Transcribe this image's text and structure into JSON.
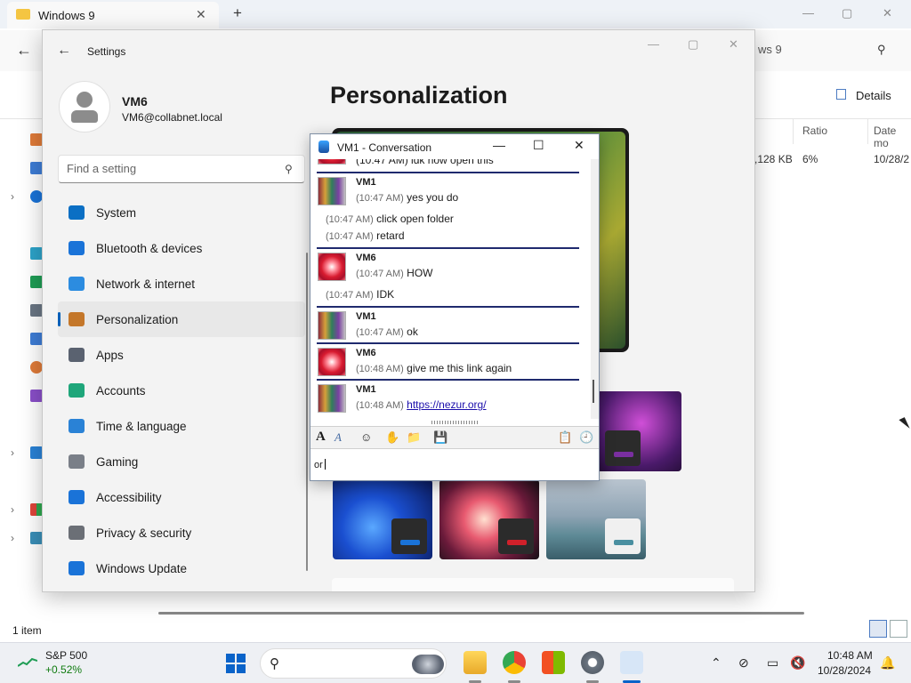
{
  "explorer": {
    "tab_title": "Windows 9",
    "tab_close": "✕",
    "new_tab": "+",
    "back": "←",
    "address_tail": "ws 9",
    "details_label": "Details",
    "columns": {
      "ratio": "Ratio",
      "date": "Date mo"
    },
    "row": {
      "size": ",128 KB",
      "ratio": "6%",
      "date": "10/28/2"
    },
    "status": "1 item",
    "window_controls": {
      "minimize": "—",
      "maximize": "▢",
      "close": "✕"
    }
  },
  "settings": {
    "app_title": "Settings",
    "back": "←",
    "window_controls": {
      "minimize": "—",
      "maximize": "▢",
      "close": "✕"
    },
    "user": {
      "name": "VM6",
      "email": "VM6@collabnet.local"
    },
    "search_placeholder": "Find a setting",
    "search_icon": "search-icon",
    "nav": [
      {
        "label": "System",
        "icon": "system-icon",
        "color": "#0b6fc4",
        "active": false
      },
      {
        "label": "Bluetooth & devices",
        "icon": "bluetooth-icon",
        "color": "#1a73d8",
        "active": false
      },
      {
        "label": "Network & internet",
        "icon": "wifi-icon",
        "color": "#2c8ce0",
        "active": false
      },
      {
        "label": "Personalization",
        "icon": "brush-icon",
        "color": "#c4772a",
        "active": true
      },
      {
        "label": "Apps",
        "icon": "apps-icon",
        "color": "#5a6270",
        "active": false
      },
      {
        "label": "Accounts",
        "icon": "accounts-icon",
        "color": "#1fa67a",
        "active": false
      },
      {
        "label": "Time & language",
        "icon": "clock-globe-icon",
        "color": "#2a82d6",
        "active": false
      },
      {
        "label": "Gaming",
        "icon": "gamepad-icon",
        "color": "#7a7f88",
        "active": false
      },
      {
        "label": "Accessibility",
        "icon": "accessibility-icon",
        "color": "#1a73d8",
        "active": false
      },
      {
        "label": "Privacy & security",
        "icon": "shield-icon",
        "color": "#6b6f76",
        "active": false
      },
      {
        "label": "Windows Update",
        "icon": "update-icon",
        "color": "#1a73d8",
        "active": false
      }
    ],
    "page_title": "Personalization"
  },
  "conversation": {
    "title": "VM1 - Conversation",
    "window_controls": {
      "minimize": "—",
      "maximize": "☐",
      "close": "✕"
    },
    "partial_top": "(10:47 AM) idk how open this",
    "blocks": [
      {
        "sender": "VM1",
        "avatar": "vm1",
        "lines": [
          {
            "time": "(10:47 AM)",
            "text": "yes you do"
          }
        ]
      },
      {
        "sender": "",
        "avatar": "",
        "lines": [
          {
            "time": "(10:47 AM)",
            "text": "click open folder"
          },
          {
            "time": "(10:47 AM)",
            "text": "retard"
          }
        ]
      },
      {
        "sender": "VM6",
        "avatar": "vm6",
        "lines": [
          {
            "time": "(10:47 AM)",
            "text": "HOW"
          }
        ]
      },
      {
        "sender": "",
        "avatar": "",
        "lines": [
          {
            "time": "(10:47 AM)",
            "text": "IDK"
          }
        ]
      },
      {
        "sender": "VM1",
        "avatar": "vm1",
        "lines": [
          {
            "time": "(10:47 AM)",
            "text": "ok"
          }
        ]
      },
      {
        "sender": "VM6",
        "avatar": "vm6",
        "lines": [
          {
            "time": "(10:48 AM)",
            "text": "give me this link again"
          }
        ]
      },
      {
        "sender": "VM1",
        "avatar": "vm1",
        "lines": [
          {
            "time": "(10:48 AM)",
            "text": "https://nezur.org/",
            "is_link": true
          }
        ]
      }
    ],
    "toolbar_icons": [
      "font-icon",
      "font-style-icon",
      "emoticon-icon",
      "nudge-icon",
      "send-files-icon",
      "save-icon",
      "invite-icon",
      "history-icon"
    ],
    "input_value": "or"
  },
  "taskbar": {
    "stock": {
      "name": "S&P 500",
      "change": "+0.52%"
    },
    "search_label": "Search",
    "apps": [
      "file-explorer-icon",
      "chrome-icon",
      "microsoft-store-icon",
      "settings-icon",
      "messenger-icon"
    ],
    "tray_icons": [
      "chevron-up-icon",
      "network-off-icon",
      "display-icon",
      "volume-mute-icon"
    ],
    "time": "10:48 AM",
    "date": "10/28/2024",
    "notification_icon": "bell-icon"
  }
}
